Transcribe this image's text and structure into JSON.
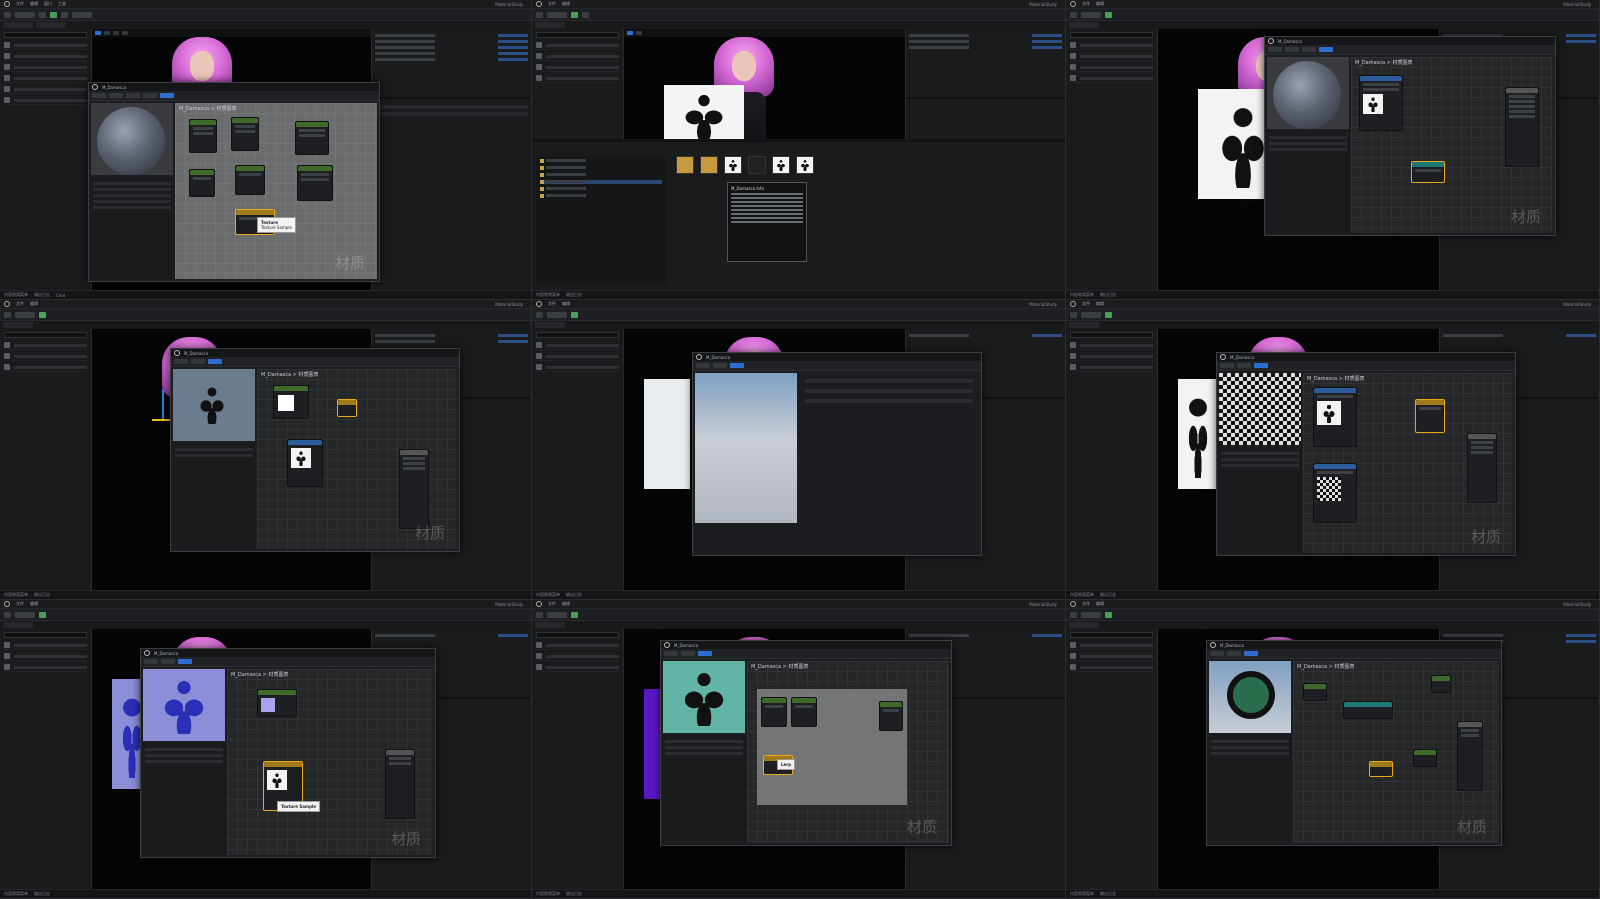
{
  "menu_items": [
    "文件",
    "编辑",
    "窗口",
    "工具",
    "构建",
    "选择",
    "演员",
    "帮助"
  ],
  "project_name": "MaterialStudy",
  "status_items": [
    "内容侧滑菜单",
    "输出日志",
    "Cmd",
    "输入控制台命令"
  ],
  "level_name": "Untitled",
  "watermark": "材质",
  "material_name": "M_Damasca",
  "breadcrumb": "M_Damasca > 材质图表",
  "tiles": [
    {
      "id": "tile-1",
      "tooltip_title": "Texture",
      "tooltip_text": "Texture Sample"
    },
    {
      "id": "tile-2",
      "tip_header": "M_Damasca Info"
    },
    {
      "id": "tile-3"
    },
    {
      "id": "tile-4"
    },
    {
      "id": "tile-5"
    },
    {
      "id": "tile-6"
    },
    {
      "id": "tile-7",
      "tooltip_title": "Texture Sample"
    },
    {
      "id": "tile-8",
      "tooltip_title": "Lerp"
    },
    {
      "id": "tile-9"
    }
  ],
  "colors": {
    "accent_blue": "#2d6fd0",
    "node_green": "#3e6b2a",
    "selection_orange": "#e8a81c",
    "hair_pink": "#e48be6"
  },
  "icons": [
    "unreal-logo-icon",
    "play-icon",
    "search-icon",
    "folder-icon",
    "eye-icon"
  ]
}
